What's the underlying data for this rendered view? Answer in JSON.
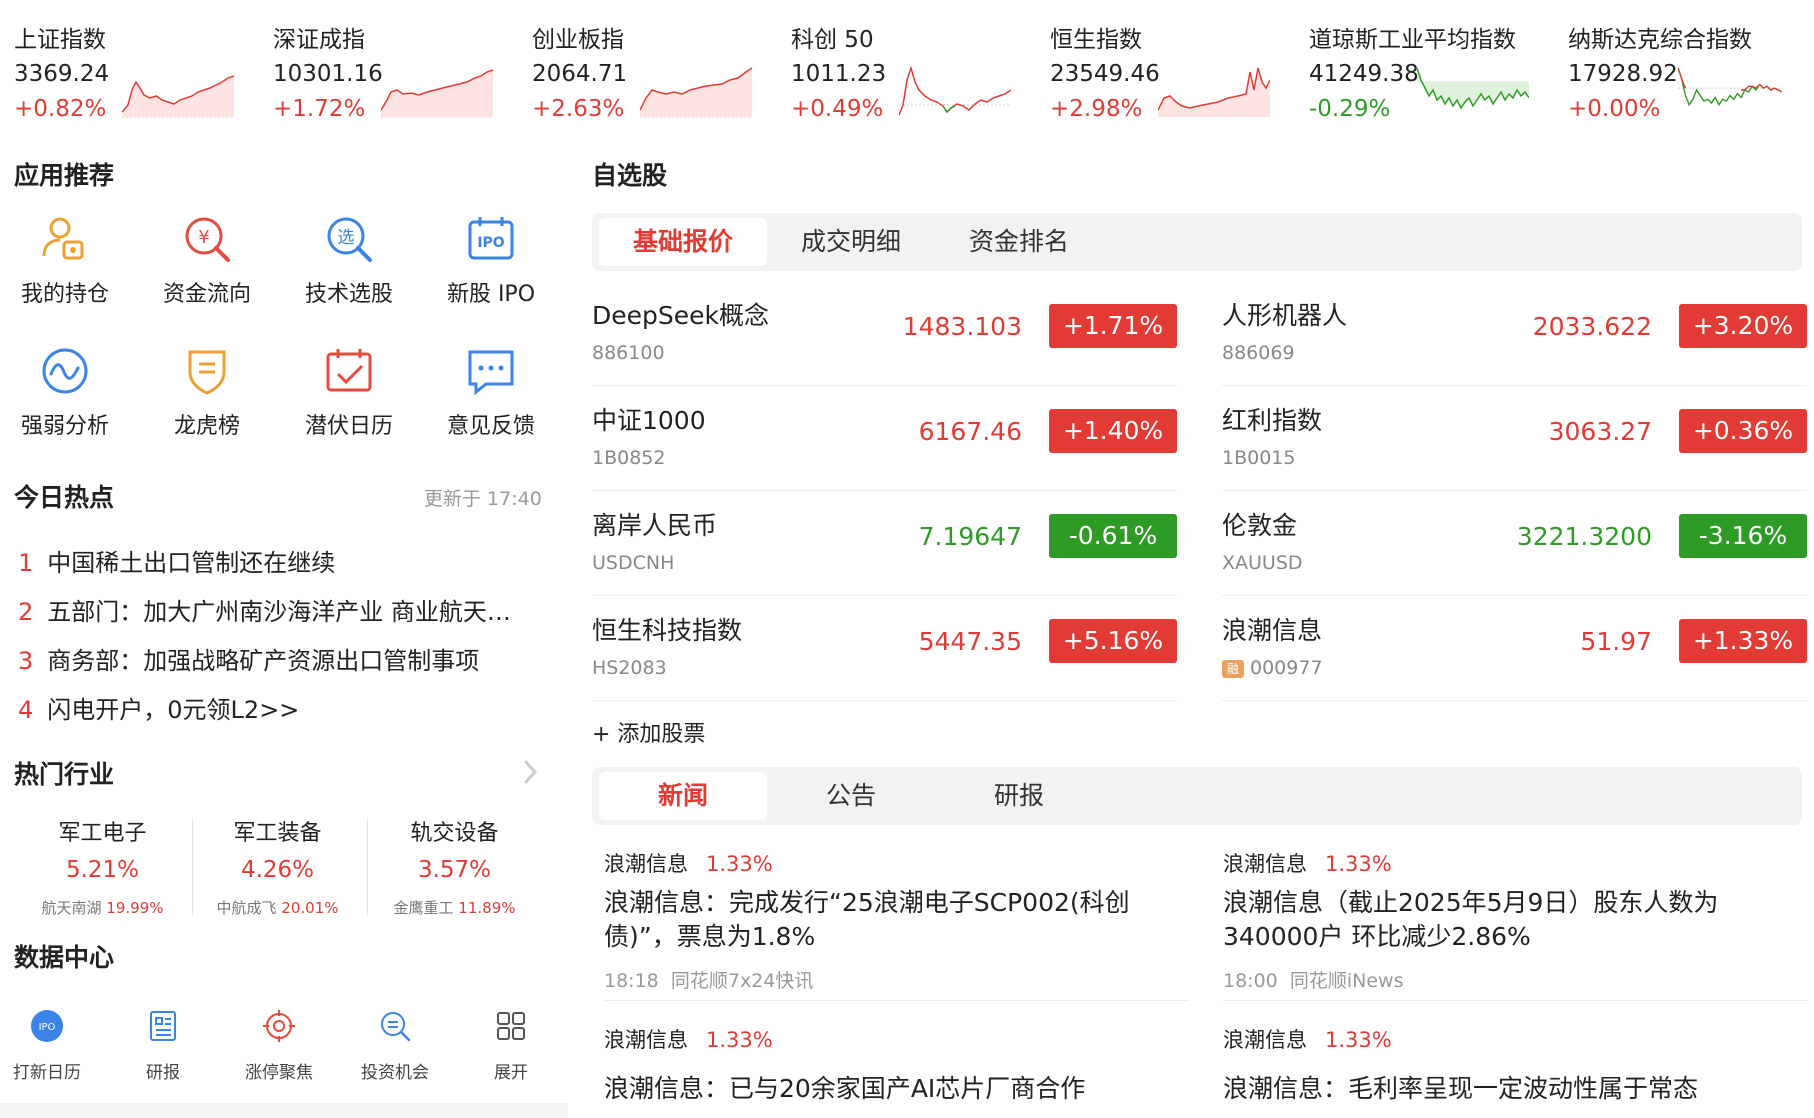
{
  "indices": [
    {
      "name": "上证指数",
      "value": "3369.24",
      "change": "+0.82%",
      "dir": "up"
    },
    {
      "name": "深证成指",
      "value": "10301.16",
      "change": "+1.72%",
      "dir": "up"
    },
    {
      "name": "创业板指",
      "value": "2064.71",
      "change": "+2.63%",
      "dir": "up"
    },
    {
      "name": "科创 50",
      "value": "1011.23",
      "change": "+0.49%",
      "dir": "up"
    },
    {
      "name": "恒生指数",
      "value": "23549.46",
      "change": "+2.98%",
      "dir": "up"
    },
    {
      "name": "道琼斯工业平均指数",
      "value": "41249.38",
      "change": "-0.29%",
      "dir": "down"
    },
    {
      "name": "纳斯达克综合指数",
      "value": "17928.92",
      "change": "+0.00%",
      "dir": "up"
    }
  ],
  "apps": {
    "title": "应用推荐",
    "items": [
      {
        "label": "我的持仓",
        "icon": "portfolio-icon"
      },
      {
        "label": "资金流向",
        "icon": "money-flow-icon"
      },
      {
        "label": "技术选股",
        "icon": "stock-picker-icon"
      },
      {
        "label": "新股 IPO",
        "icon": "ipo-calendar-icon"
      },
      {
        "label": "强弱分析",
        "icon": "strength-analysis-icon"
      },
      {
        "label": "龙虎榜",
        "icon": "dragon-tiger-icon"
      },
      {
        "label": "潜伏日历",
        "icon": "calendar-icon"
      },
      {
        "label": "意见反馈",
        "icon": "feedback-icon"
      }
    ]
  },
  "hot": {
    "title": "今日热点",
    "updated": "更新于 17:40",
    "items": [
      {
        "num": "1",
        "text": "中国稀土出口管制还在继续"
      },
      {
        "num": "2",
        "text": "五部门：加大广州南沙海洋产业 商业航天支持力度"
      },
      {
        "num": "3",
        "text": "商务部：加强战略矿产资源出口管制事项"
      },
      {
        "num": "4",
        "text": "闪电开户，0元领L2>>"
      }
    ]
  },
  "industry": {
    "title": "热门行业",
    "items": [
      {
        "name": "军工电子",
        "pct": "5.21%",
        "stock": "航天南湖",
        "stock_pct": "19.99%"
      },
      {
        "name": "军工装备",
        "pct": "4.26%",
        "stock": "中航成飞",
        "stock_pct": "20.01%"
      },
      {
        "name": "轨交设备",
        "pct": "3.57%",
        "stock": "金鹰重工",
        "stock_pct": "11.89%"
      }
    ]
  },
  "datacenter": {
    "title": "数据中心",
    "items": [
      {
        "label": "打新日历",
        "icon": "ipo-badge-icon"
      },
      {
        "label": "研报",
        "icon": "report-icon"
      },
      {
        "label": "涨停聚焦",
        "icon": "target-icon"
      },
      {
        "label": "投资机会",
        "icon": "search-opportunity-icon"
      },
      {
        "label": "展开",
        "icon": "grid-icon"
      }
    ]
  },
  "watchlist": {
    "title": "自选股",
    "tabs": [
      "基础报价",
      "成交明细",
      "资金排名"
    ],
    "add_label": "+ 添加股票",
    "stocks": [
      {
        "name": "DeepSeek概念",
        "code": "886100",
        "price": "1483.103",
        "change": "+1.71%",
        "dir": "up"
      },
      {
        "name": "人形机器人",
        "code": "886069",
        "price": "2033.622",
        "change": "+3.20%",
        "dir": "up"
      },
      {
        "name": "中证1000",
        "code": "1B0852",
        "price": "6167.46",
        "change": "+1.40%",
        "dir": "up"
      },
      {
        "name": "红利指数",
        "code": "1B0015",
        "price": "3063.27",
        "change": "+0.36%",
        "dir": "up"
      },
      {
        "name": "离岸人民币",
        "code": "USDCNH",
        "price": "7.19647",
        "change": "-0.61%",
        "dir": "down"
      },
      {
        "name": "伦敦金",
        "code": "XAUUSD",
        "price": "3221.3200",
        "change": "-3.16%",
        "dir": "down"
      },
      {
        "name": "恒生科技指数",
        "code": "HS2083",
        "price": "5447.35",
        "change": "+5.16%",
        "dir": "up"
      },
      {
        "name": "浪潮信息",
        "code": "000977",
        "tag": "融",
        "price": "51.97",
        "change": "+1.33%",
        "dir": "up"
      }
    ]
  },
  "news": {
    "tabs": [
      "新闻",
      "公告",
      "研报"
    ],
    "items": [
      {
        "stock": "浪潮信息",
        "pct": "1.33%",
        "title": "浪潮信息：完成发行“25浪潮电子SCP002(科创债)”，票息为1.8%",
        "time": "18:18",
        "source": "同花顺7x24快讯"
      },
      {
        "stock": "浪潮信息",
        "pct": "1.33%",
        "title": "浪潮信息（截止2025年5月9日）股东人数为340000户 环比减少2.86%",
        "time": "18:00",
        "source": "同花顺iNews"
      },
      {
        "stock": "浪潮信息",
        "pct": "1.33%",
        "title": "浪潮信息：已与20余家国产AI芯片厂商合作",
        "time": "",
        "source": ""
      },
      {
        "stock": "浪潮信息",
        "pct": "1.33%",
        "title": "浪潮信息：毛利率呈现一定波动性属于常态",
        "time": "",
        "source": ""
      }
    ]
  },
  "colors": {
    "up": "#e23b35",
    "down": "#2f9b27",
    "accent": "#e23b35"
  }
}
